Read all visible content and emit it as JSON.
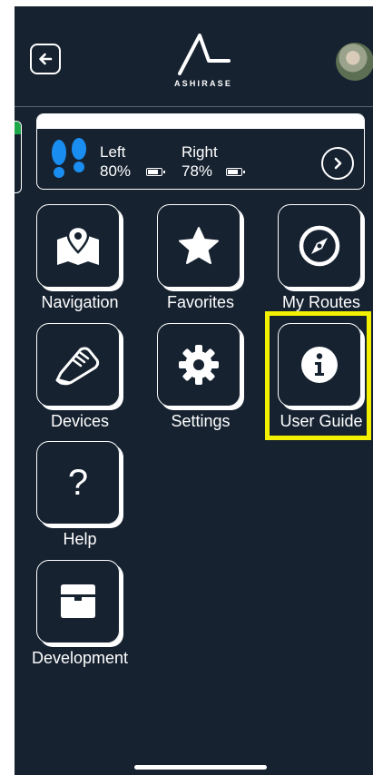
{
  "header": {
    "back_icon": "arrow-left-icon",
    "logo_text": "ASHIRASE",
    "avatar": "user-avatar"
  },
  "device": {
    "left_label": "Left",
    "left_battery": "80%",
    "right_label": "Right",
    "right_battery": "78%",
    "feet_icon": "footprints-icon",
    "feet_color": "#1a8df0",
    "next_icon": "chevron-right-icon"
  },
  "menu": {
    "navigation": {
      "label": "Navigation",
      "icon": "map-pin-icon"
    },
    "favorites": {
      "label": "Favorites",
      "icon": "star-icon"
    },
    "my_routes": {
      "label": "My Routes",
      "icon": "compass-icon"
    },
    "devices": {
      "label": "Devices",
      "icon": "shoe-icon"
    },
    "settings": {
      "label": "Settings",
      "icon": "gear-icon"
    },
    "user_guide": {
      "label": "User Guide",
      "icon": "info-icon"
    },
    "help": {
      "label": "Help",
      "icon_text": "?"
    },
    "development": {
      "label": "Development",
      "icon": "box-icon"
    }
  },
  "highlight_color": "#f3f000"
}
